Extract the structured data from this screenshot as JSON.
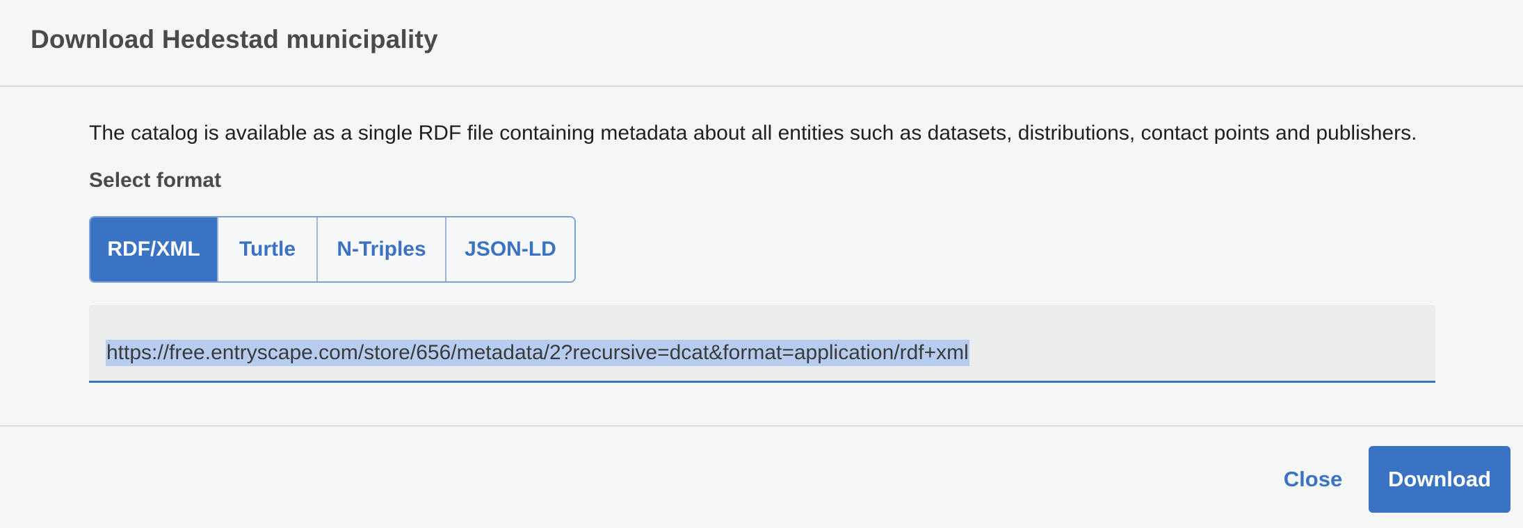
{
  "dialog": {
    "title": "Download Hedestad municipality"
  },
  "body": {
    "description": "The catalog is available as a single RDF file containing metadata about all entities such as datasets, distributions, contact points and publishers.",
    "format_label": "Select format",
    "formats": [
      {
        "label": "RDF/XML",
        "selected": true
      },
      {
        "label": "Turtle",
        "selected": false
      },
      {
        "label": "N-Triples",
        "selected": false
      },
      {
        "label": "JSON-LD",
        "selected": false
      }
    ],
    "url": "https://free.entryscape.com/store/656/metadata/2?recursive=dcat&format=application/rdf+xml"
  },
  "footer": {
    "close_label": "Close",
    "download_label": "Download"
  },
  "colors": {
    "accent": "#3a72c4",
    "background": "#f5f6f6",
    "selection_highlight": "#b7cdef"
  }
}
